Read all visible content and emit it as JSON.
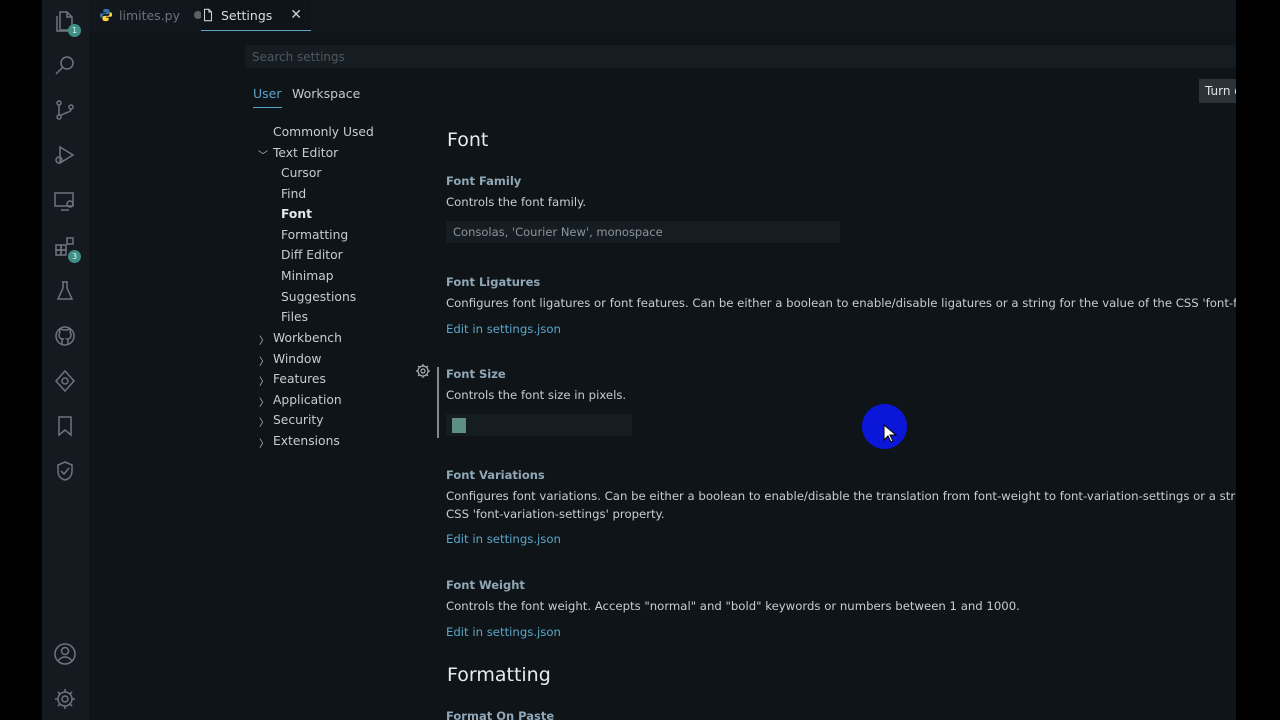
{
  "activity_bar": {
    "explorer_badge": "1",
    "extensions_badge": "3",
    "icons": [
      "files-icon",
      "search-icon",
      "source-control-icon",
      "run-debug-icon",
      "remote-explorer-icon",
      "extensions-icon",
      "testing-icon",
      "github-icon",
      "gitlens-icon",
      "bookmarks-icon",
      "checkmark-shield-icon",
      "account-icon",
      "settings-gear-icon"
    ]
  },
  "tabs": [
    {
      "label": "limites.py",
      "dirty": true
    },
    {
      "label": "Settings",
      "active": true
    }
  ],
  "search": {
    "placeholder": "Search settings"
  },
  "scope_tabs": {
    "user": "User",
    "workspace": "Workspace"
  },
  "turn_button": "Turn o",
  "toc": {
    "commonly_used": "Commonly Used",
    "text_editor": "Text Editor",
    "cursor": "Cursor",
    "find": "Find",
    "font": "Font",
    "formatting": "Formatting",
    "diff_editor": "Diff Editor",
    "minimap": "Minimap",
    "suggestions": "Suggestions",
    "files": "Files",
    "workbench": "Workbench",
    "window": "Window",
    "features": "Features",
    "application": "Application",
    "security": "Security",
    "extensions": "Extensions"
  },
  "content": {
    "font_section": "Font",
    "font_family": {
      "title": "Font Family",
      "desc": "Controls the font family.",
      "value": "Consolas, 'Courier New', monospace"
    },
    "font_ligatures": {
      "title": "Font Ligatures",
      "desc": "Configures font ligatures or font features. Can be either a boolean to enable/disable ligatures or a string for the value of the CSS 'font-feature-settin",
      "link": "Edit in settings.json"
    },
    "font_size": {
      "title": "Font Size",
      "desc": "Controls the font size in pixels.",
      "value": ""
    },
    "font_variations": {
      "title": "Font Variations",
      "desc1": "Configures font variations. Can be either a boolean to enable/disable the translation from font-weight to font-variation-settings or a string for the v",
      "desc2": "CSS 'font-variation-settings' property.",
      "link": "Edit in settings.json"
    },
    "font_weight": {
      "title": "Font Weight",
      "desc": "Controls the font weight. Accepts \"normal\" and \"bold\" keywords or numbers between 1 and 1000.",
      "link": "Edit in settings.json"
    },
    "formatting_section": "Formatting",
    "format_on_paste": {
      "title": "Format On Paste"
    }
  },
  "colors": {
    "accent": "#5aa7c9",
    "background": "#0f1418",
    "click_indicator": "#0a17d8"
  }
}
